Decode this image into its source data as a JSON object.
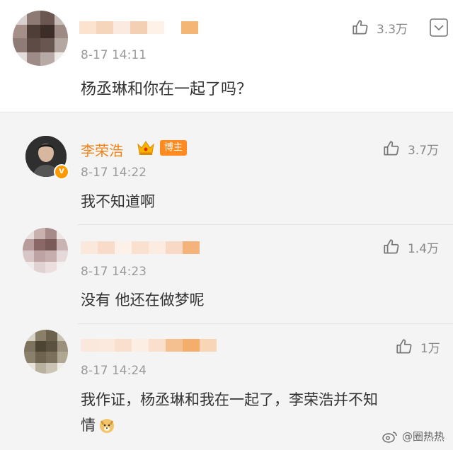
{
  "main_comment": {
    "time": "8-17 14:11",
    "text": "杨丞琳和你在一起了吗？",
    "likes": "3.3万",
    "like_icon": "thumbs-up-icon",
    "menu_icon": "chevron-down-icon"
  },
  "replies": [
    {
      "name": "李荣浩",
      "badge": "博主",
      "time": "8-17 14:22",
      "text": "我不知道啊",
      "likes": "3.7万",
      "crown_icon": "crown-icon",
      "verified_icon": "verified-v-icon",
      "verified_mark": "V"
    },
    {
      "time": "8-17 14:23",
      "text": "没有 他还在做梦呢",
      "likes": "1.4万"
    },
    {
      "time": "8-17 14:24",
      "text_line1": "我作证，杨丞琳和我在一起了，李荣浩并不知",
      "text_line2": "情",
      "emoji": "doge-emoji",
      "likes": "1万"
    }
  ],
  "watermark": "@圈热热",
  "colors": {
    "accent_orange": "#f08217",
    "badge_orange": "#ff8a1f",
    "meta_gray": "#9a9a9a",
    "reply_bg": "#f4f4f5"
  }
}
